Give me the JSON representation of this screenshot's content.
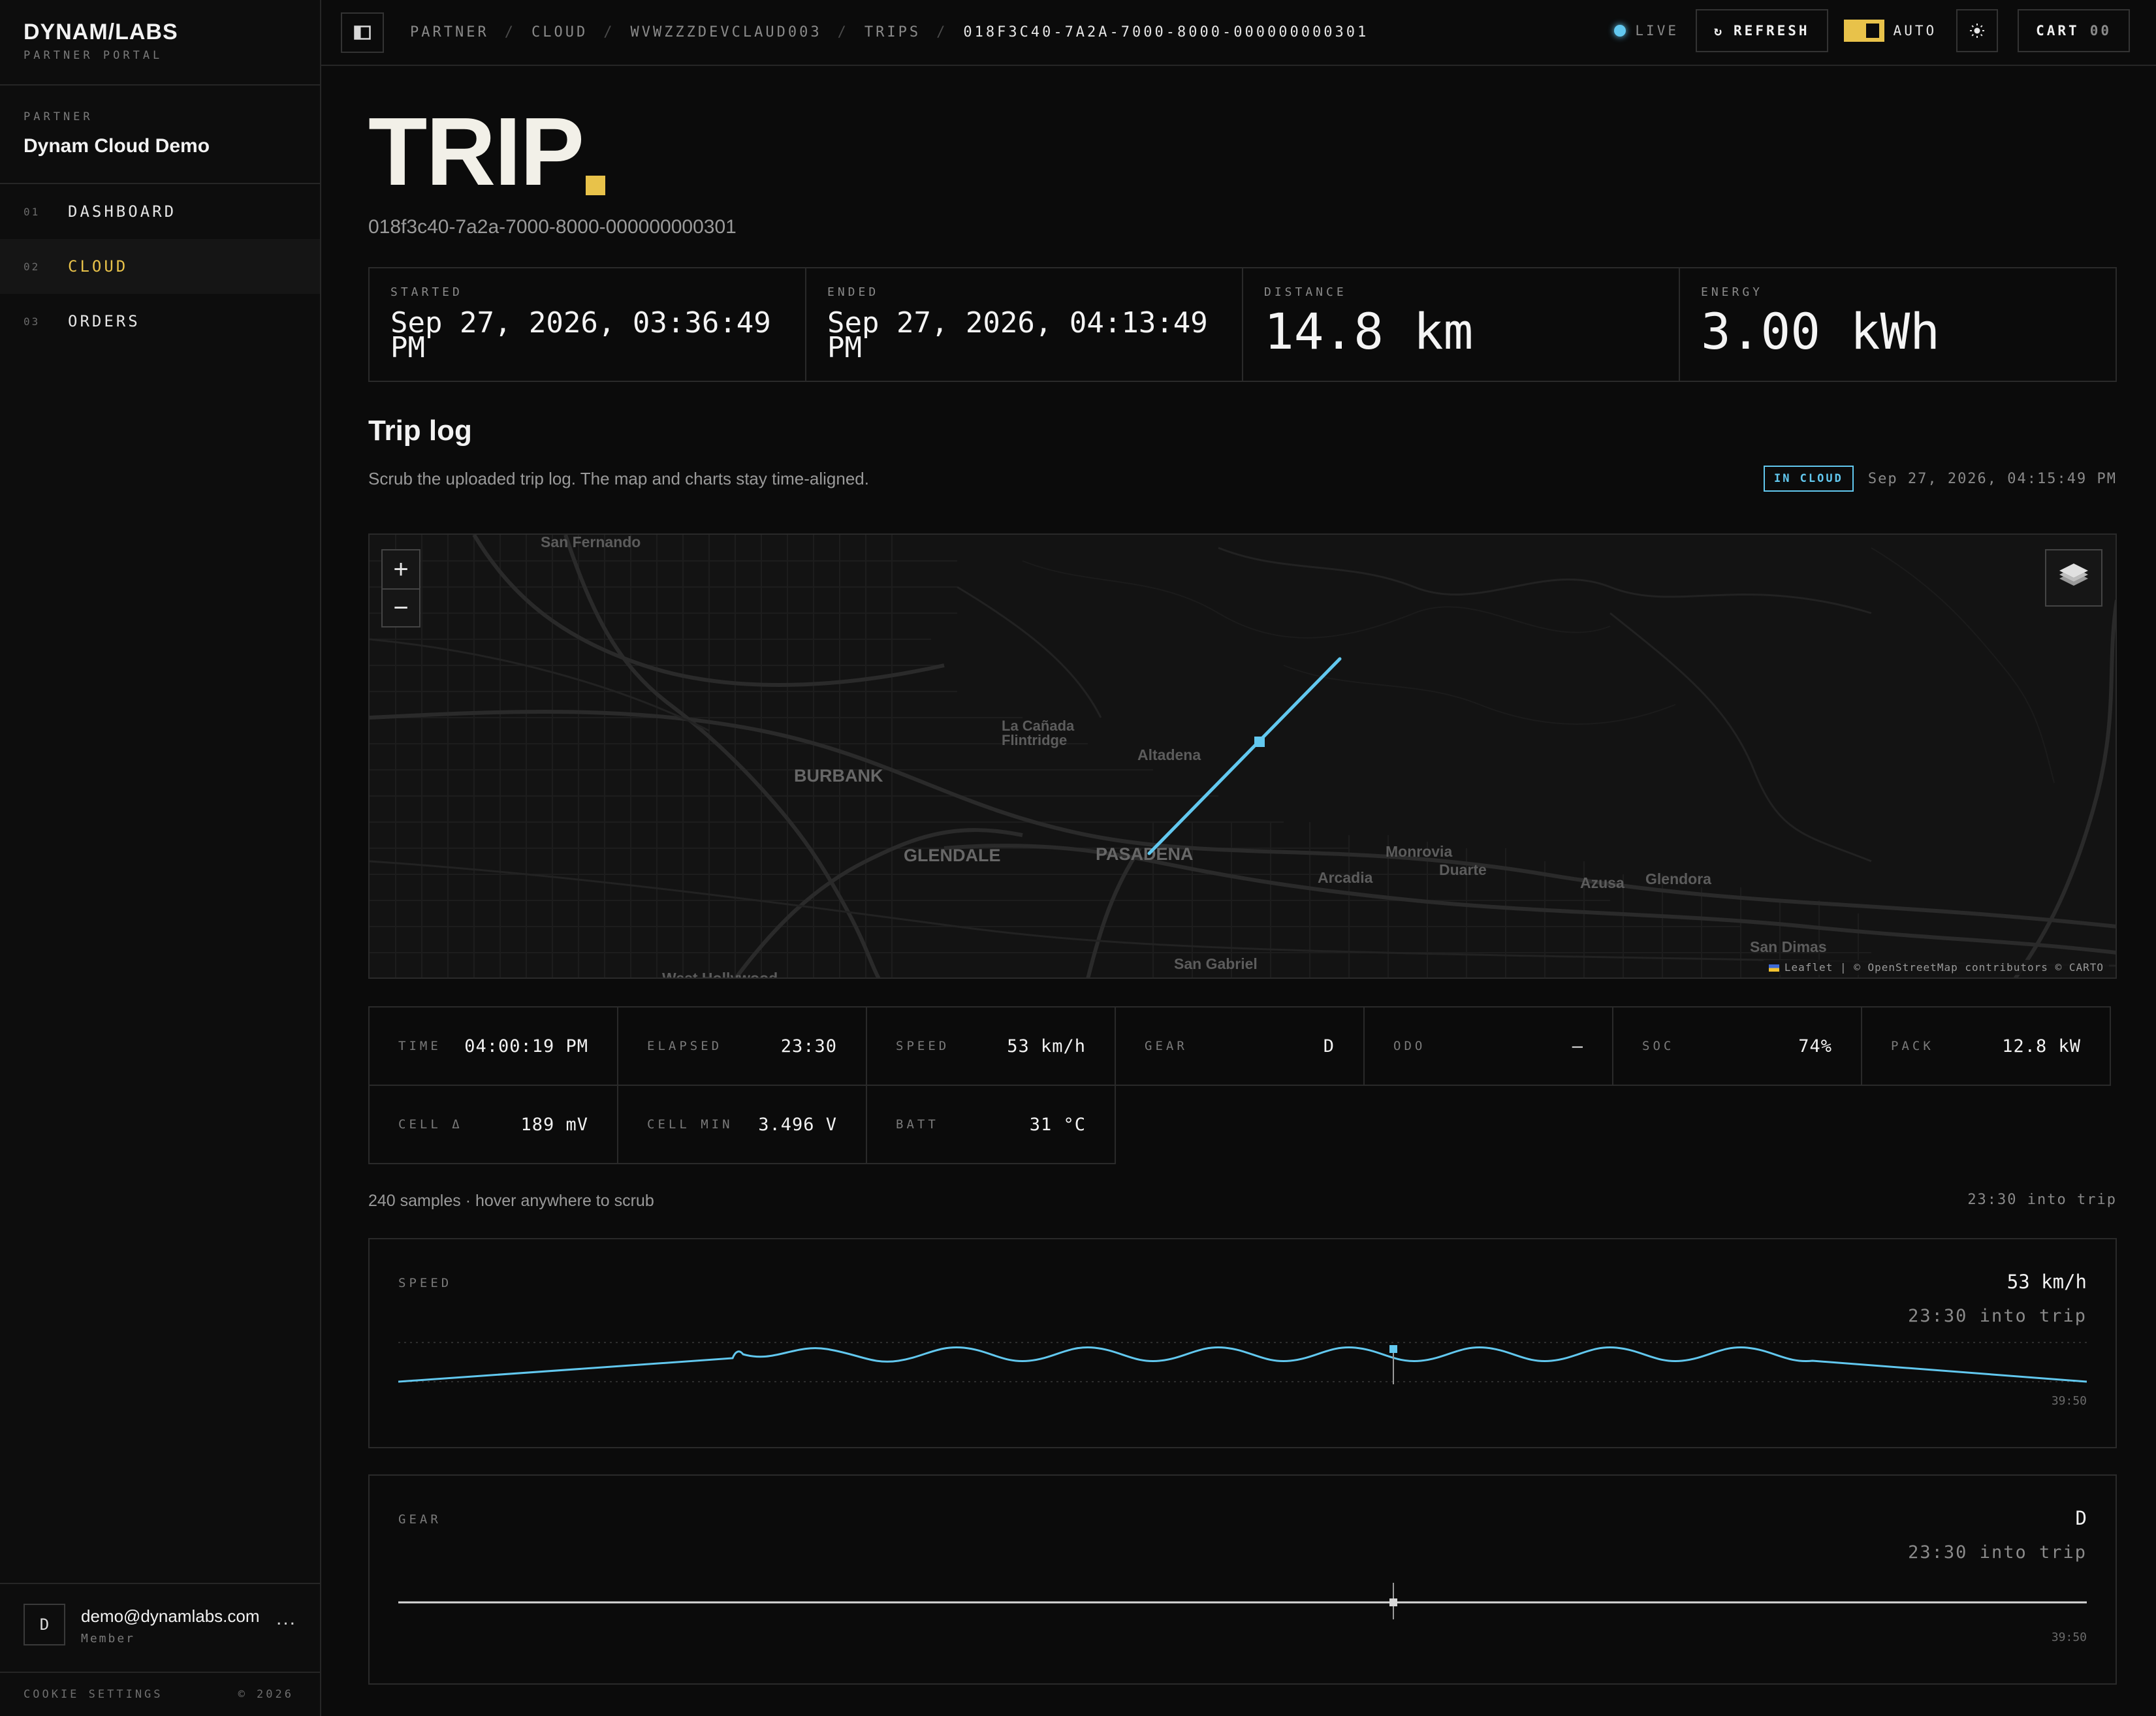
{
  "brand": {
    "logo": "DYNAM/LABS",
    "subtitle": "PARTNER PORTAL"
  },
  "partner": {
    "label": "PARTNER",
    "name": "Dynam Cloud Demo"
  },
  "nav": [
    {
      "num": "01",
      "label": "DASHBOARD"
    },
    {
      "num": "02",
      "label": "CLOUD"
    },
    {
      "num": "03",
      "label": "ORDERS"
    }
  ],
  "user": {
    "initial": "D",
    "email": "demo@dynamlabs.com",
    "role": "Member",
    "more": "..."
  },
  "footer": {
    "cookie": "COOKIE SETTINGS",
    "copyright": "© 2026"
  },
  "breadcrumbs": [
    "PARTNER",
    "CLOUD",
    "WVWZZZDEVCLAUD003",
    "TRIPS",
    "018F3C40-7A2A-7000-8000-000000000301"
  ],
  "topbar": {
    "live": "LIVE",
    "refresh": "REFRESH",
    "auto": "AUTO",
    "cart": "CART",
    "cart_count": "00"
  },
  "page": {
    "title": "TRIP",
    "trip_id": "018f3c40-7a2a-7000-8000-000000000301"
  },
  "stats": [
    {
      "label": "STARTED",
      "value": "Sep 27, 2026, 03:36:49 PM"
    },
    {
      "label": "ENDED",
      "value": "Sep 27, 2026, 04:13:49 PM"
    },
    {
      "label": "DISTANCE",
      "value": "14.8 km"
    },
    {
      "label": "ENERGY",
      "value": "3.00 kWh"
    }
  ],
  "triplog": {
    "heading": "Trip log",
    "description": "Scrub the uploaded trip log. The map and charts stay time-aligned.",
    "badge": "IN CLOUD",
    "timestamp": "Sep 27, 2026, 04:15:49 PM"
  },
  "map": {
    "zoom_in": "+",
    "zoom_out": "−",
    "attribution": "Leaflet | © OpenStreetMap contributors © CARTO",
    "places": [
      "San Fernando",
      "La Cañada",
      "Flintridge",
      "Altadena",
      "BURBANK",
      "GLENDALE",
      "PASADENA",
      "Monrovia",
      "Duarte",
      "Arcadia",
      "Azusa",
      "Glendora",
      "San Dimas",
      "San Gabriel",
      "West Hollywood"
    ],
    "route_color": "#62c8ef"
  },
  "readout": [
    {
      "label": "TIME",
      "value": "04:00:19 PM"
    },
    {
      "label": "ELAPSED",
      "value": "23:30"
    },
    {
      "label": "SPEED",
      "value": "53 km/h"
    },
    {
      "label": "GEAR",
      "value": "D"
    },
    {
      "label": "ODO",
      "value": "—"
    },
    {
      "label": "SOC",
      "value": "74%"
    },
    {
      "label": "PACK",
      "value": "12.8 kW"
    },
    {
      "label": "CELL Δ",
      "value": "189 mV"
    },
    {
      "label": "CELL MIN",
      "value": "3.496 V"
    },
    {
      "label": "BATT",
      "value": "31 °C"
    }
  ],
  "samples": {
    "text": "240 samples · hover anywhere to scrub",
    "position": "23:30 into trip"
  },
  "charts": {
    "speed": {
      "label": "SPEED",
      "value": "53 km/h",
      "sub": "23:30 into trip",
      "end": "39:50"
    },
    "gear": {
      "label": "GEAR",
      "value": "D",
      "sub": "23:30 into trip",
      "end": "39:50"
    }
  },
  "colors": {
    "accent": "#e8c24a",
    "live": "#62c8ef",
    "background": "#0b0b0b"
  }
}
